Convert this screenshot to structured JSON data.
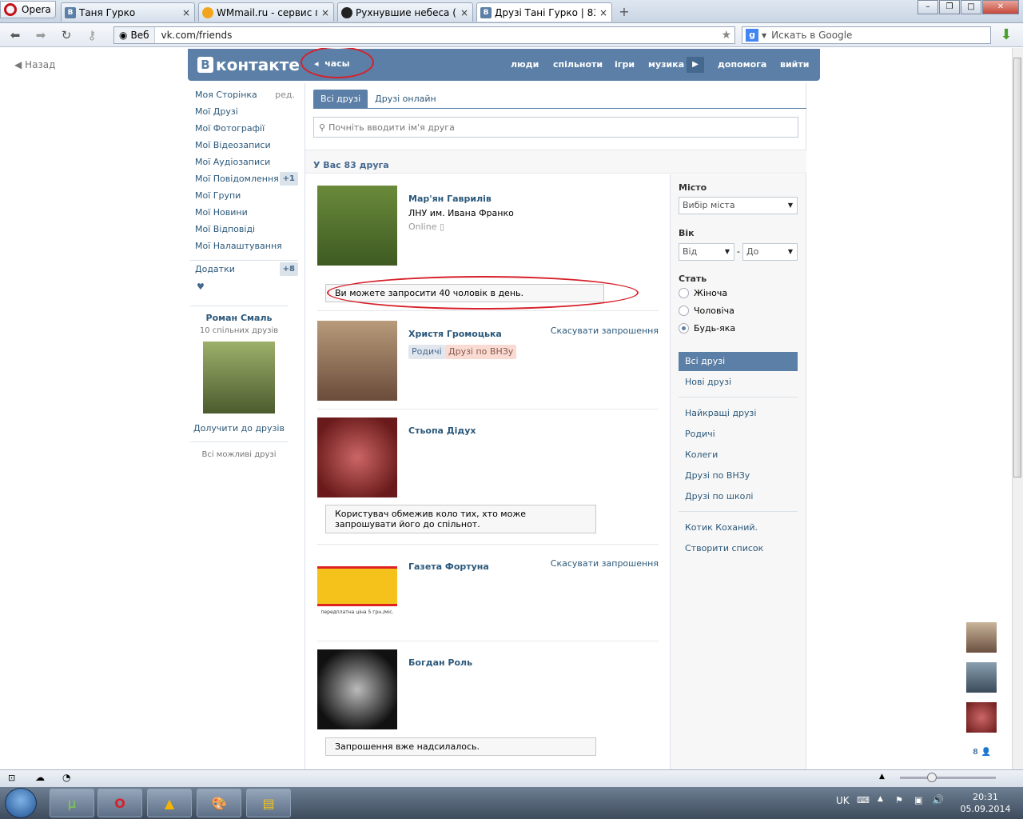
{
  "browser": {
    "app_label": "Opera",
    "tabs": [
      {
        "title": "Таня Гурко",
        "icon": "vk-favicon",
        "active": false
      },
      {
        "title": "WMmail.ru - сервис п...",
        "icon": "wmmail-favicon",
        "active": false
      },
      {
        "title": "Рухнувшие небеса (4 ...",
        "icon": "panda-favicon",
        "active": false
      },
      {
        "title": "Друзі Тані Гурко | 83 д...",
        "icon": "vk-favicon",
        "active": true
      }
    ],
    "web_badge": "Веб",
    "url": "vk.com/friends",
    "search_placeholder": "Искать в Google"
  },
  "page": {
    "back_label": "Назад",
    "logo_text": "контакте",
    "logo_letter": "В",
    "music_track": "часы",
    "top_nav": [
      "люди",
      "спільноти",
      "ігри",
      "музика",
      "допомога",
      "вийти"
    ],
    "left_menu": [
      {
        "label": "Моя Сторінка",
        "extra": "ред."
      },
      {
        "label": "Мої Друзі"
      },
      {
        "label": "Мої Фотографії"
      },
      {
        "label": "Мої Відеозаписи"
      },
      {
        "label": "Мої Аудіозаписи"
      },
      {
        "label": "Мої Повідомлення",
        "count": "+1"
      },
      {
        "label": "Мої Групи"
      },
      {
        "label": "Мої Новини"
      },
      {
        "label": "Мої Відповіді"
      },
      {
        "label": "Мої Налаштування"
      }
    ],
    "apps": {
      "label": "Додатки",
      "count": "+8"
    },
    "heart": "♥",
    "suggestion": {
      "name": "Роман Смаль",
      "common": "10 спільних друзів",
      "add": "Долучити до друзів",
      "all": "Всі можливі друзі"
    },
    "friend_tabs": [
      "Всі друзі",
      "Друзі онлайн"
    ],
    "search_placeholder": "Почніть вводити ім'я друга",
    "count_text": "У Вас 83 друга",
    "friends": [
      {
        "name": "Мар'ян Гаврилів",
        "info": "ЛНУ им. Ивана Франко",
        "status": "Online",
        "note": "Ви можете запросити 40 чоловік в день."
      },
      {
        "name": "Христя Громоцька",
        "action": "Скасувати запрошення",
        "tags": [
          "Родичі",
          "Друзі по ВНЗу"
        ]
      },
      {
        "name": "Стьопа Дідух",
        "note": "Користувач обмежив коло тих, хто може запрошувати його до спільнот."
      },
      {
        "name": "Газета Фортуна",
        "action": "Скасувати запрошення",
        "image_caption": "передплатна ціна 5 грн./міс."
      },
      {
        "name": "Богдан Роль",
        "note": "Запрошення вже надсилалось."
      }
    ],
    "filter": {
      "city_label": "Місто",
      "city_value": "Вибір міста",
      "age_label": "Вік",
      "age_from": "Від",
      "age_dash": "-",
      "age_to": "До",
      "sex_label": "Стать",
      "sex_options": [
        "Жіноча",
        "Чоловіча",
        "Будь-яка"
      ],
      "sex_selected": "Будь-яка",
      "lists_a": [
        "Всі друзі",
        "Нові друзі"
      ],
      "lists_b": [
        "Найкращі друзі",
        "Родичі",
        "Колеги",
        "Друзі по ВНЗу",
        "Друзі по школі"
      ],
      "lists_c": [
        "Котик Коханий.",
        "Створити список"
      ]
    },
    "online_count": "8"
  },
  "system": {
    "lang": "UK",
    "time": "20:31",
    "date": "05.09.2014"
  },
  "colors": {
    "vk_blue": "#5b7fa6",
    "link": "#2b587a",
    "annotation_red": "#d7202a"
  }
}
